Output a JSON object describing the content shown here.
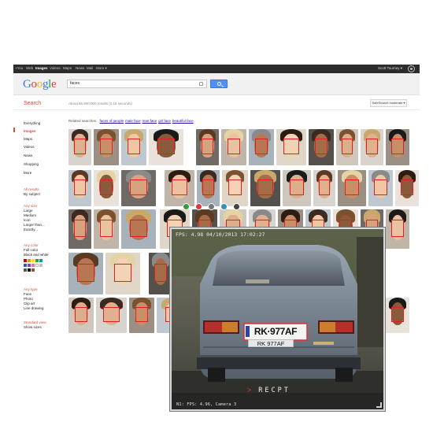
{
  "topbar": {
    "nav": [
      "+You",
      "Web",
      "Images",
      "Videos",
      "Maps",
      "News",
      "Mail",
      "More ▾"
    ],
    "active_nav": "Images",
    "user": "Scott Tourney ▾"
  },
  "google": {
    "logo_letters": [
      "G",
      "o",
      "o",
      "g",
      "l",
      "e"
    ],
    "logo_colors": [
      "#3c78d8",
      "#dd3d31",
      "#f2b42b",
      "#3c78d8",
      "#1f9e48",
      "#dd3d31"
    ],
    "search_value": "faces",
    "search_label": "Search",
    "results_count": "About 65,900,000 results (0.15 seconds)",
    "safesearch": "SafeSearch moderate ▾"
  },
  "sidebar": {
    "types": [
      "Everything",
      "Images",
      "Maps",
      "Videos",
      "News",
      "Shopping",
      "More"
    ],
    "selected": "Images",
    "filters": [
      "All results",
      "By subject"
    ],
    "size_head": "Any size",
    "sizes": [
      "Large",
      "Medium",
      "Icon",
      "Larger than...",
      "Exactly..."
    ],
    "color_head": "Any color",
    "colors": [
      "Full color",
      "Black and white"
    ],
    "swatches": [
      "#cc0000",
      "#f4901e",
      "#ffe100",
      "#2ba52e",
      "#00a2a0",
      "#2b57d1",
      "#8e3ec9",
      "#e86fb1",
      "#ffffff",
      "#c0c0c0",
      "#555555",
      "#000000",
      "#8b5a2b"
    ],
    "type_head": "Any type",
    "types_list": [
      "Face",
      "Photo",
      "Clip art",
      "Line drawing"
    ],
    "view_head": "Standard view",
    "view_sizes": "Show sizes"
  },
  "related": {
    "prefix": "Related searches:",
    "links": [
      "faces of people",
      "male face",
      "man face",
      "girl face",
      "beautiful face"
    ]
  },
  "toolbar_icons": [
    {
      "name": "share-icon",
      "color": "#3a9b3a"
    },
    {
      "name": "record-icon",
      "color": "#d93c3c"
    },
    {
      "name": "camera-icon",
      "color": "#777777"
    },
    {
      "name": "globe-icon",
      "color": "#3a8fb7"
    },
    {
      "name": "settings-icon",
      "color": "#444444"
    }
  ],
  "camera": {
    "fps_top": "FPS: 4.98 04/10/2013 17:02:27",
    "plate": "RK·977AF",
    "plate_label": "RK 977AF",
    "brand_arrow": ">",
    "brand": "RECPT",
    "fps_bottom": "N1: FPS: 4.96, Camera 3"
  }
}
